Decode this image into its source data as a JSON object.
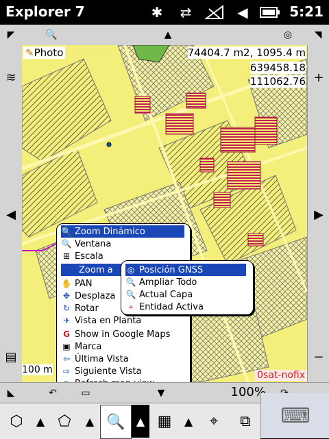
{
  "status_bar": {
    "title": "Explorer 7",
    "time": "5:21"
  },
  "map": {
    "photo_label": "Photo",
    "area_readout": "74404.7 m2, 1095.4 m",
    "coord_x": "639458.18",
    "coord_y": "111062.76",
    "scale_label": "100 m",
    "nofix_label": "0sat-nofix"
  },
  "bottom_toolbar": {
    "zoom_level": "100%"
  },
  "context_menu": {
    "items": [
      {
        "label": "Zoom Dinámico",
        "icon": "zoom-dynamic-icon"
      },
      {
        "label": "Ventana",
        "icon": "zoom-window-icon"
      },
      {
        "label": "Escala",
        "icon": "scale-icon"
      },
      {
        "label": "Zoom a",
        "icon": ""
      },
      {
        "label": "PAN",
        "icon": "hand-icon"
      },
      {
        "label": "Desplaza",
        "icon": "move-icon"
      },
      {
        "label": "Rotar",
        "icon": "rotate-icon"
      },
      {
        "label": "Vista en Planta",
        "icon": "plane-icon"
      },
      {
        "label": "Show in Google Maps",
        "icon": "google-icon"
      },
      {
        "label": "Marca",
        "icon": "marker-icon"
      },
      {
        "label": "Última Vista",
        "icon": "back-arrow-icon"
      },
      {
        "label": "Siguiente Vista",
        "icon": "forward-arrow-icon"
      },
      {
        "label": "Refresh map view",
        "icon": "refresh-icon"
      }
    ]
  },
  "submenu": {
    "items": [
      {
        "label": "Posición GNSS",
        "icon": "gnss-icon"
      },
      {
        "label": "Ampliar Todo",
        "icon": "zoom-all-icon"
      },
      {
        "label": "Actual Capa",
        "icon": "layer-icon"
      },
      {
        "label": "Entidad Activa",
        "icon": "entity-icon"
      }
    ]
  }
}
